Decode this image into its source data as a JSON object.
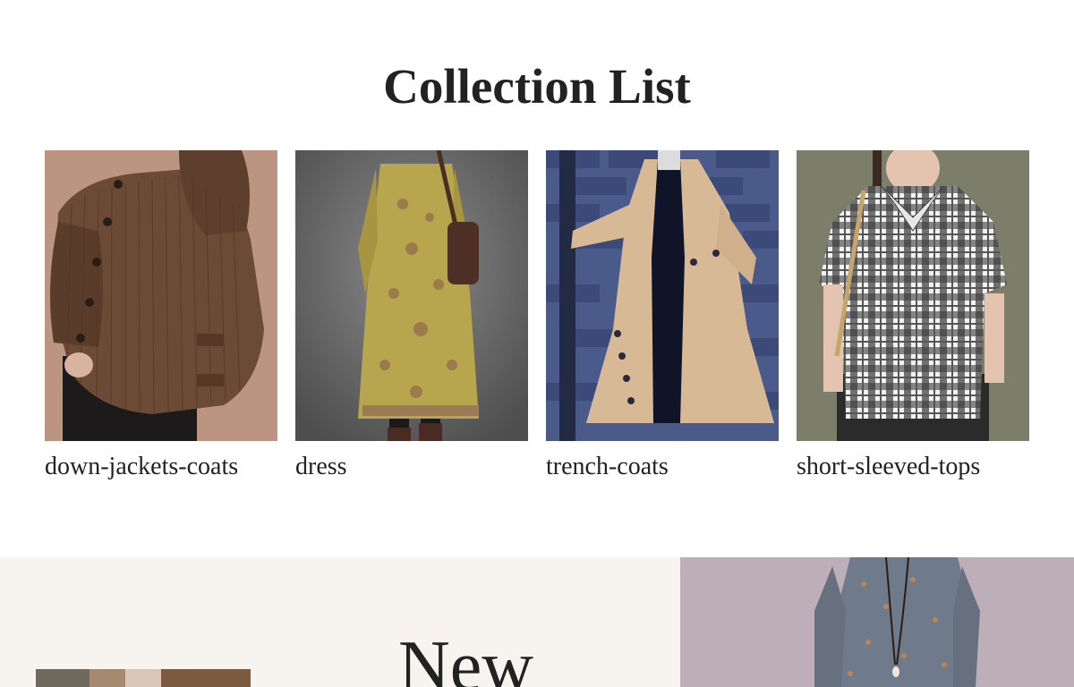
{
  "collection": {
    "title": "Collection List",
    "items": [
      {
        "label": "down-jackets-coats",
        "image": "brown-corduroy-hooded-jacket"
      },
      {
        "label": "dress",
        "image": "olive-printed-long-dress"
      },
      {
        "label": "trench-coats",
        "image": "beige-trench-coat"
      },
      {
        "label": "short-sleeved-tops",
        "image": "plaid-short-sleeve-top"
      }
    ]
  },
  "new_section": {
    "title": "New"
  },
  "colors": {
    "text": "#222222",
    "new_section_bg": "#f7f4ef",
    "promo_bg": "#b9a9b3"
  }
}
